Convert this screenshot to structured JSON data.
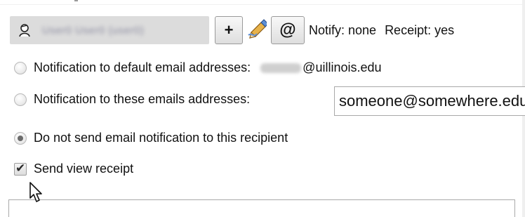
{
  "recipient": {
    "name": "User0 User0 (user0)"
  },
  "buttons": {
    "add_label": "+",
    "at_label": "@"
  },
  "status": {
    "notify": "Notify: none",
    "receipt": "Receipt: yes"
  },
  "options": {
    "default_email": {
      "label": "Notification to default email addresses:",
      "domain": "@uillinois.edu"
    },
    "custom_email": {
      "label": "Notification to these emails addresses:",
      "value": "someone@somewhere.edu"
    },
    "no_email": {
      "label": "Do not send email notification to this recipient"
    }
  },
  "send_view_receipt": {
    "label": "Send view receipt",
    "checked": true
  },
  "colors": {
    "chip_background": "#dcdcdc",
    "text": "#111111",
    "border": "#a9a9a9"
  },
  "icons": [
    "user-icon",
    "edit-pencil-icon",
    "mouse-cursor-icon"
  ]
}
